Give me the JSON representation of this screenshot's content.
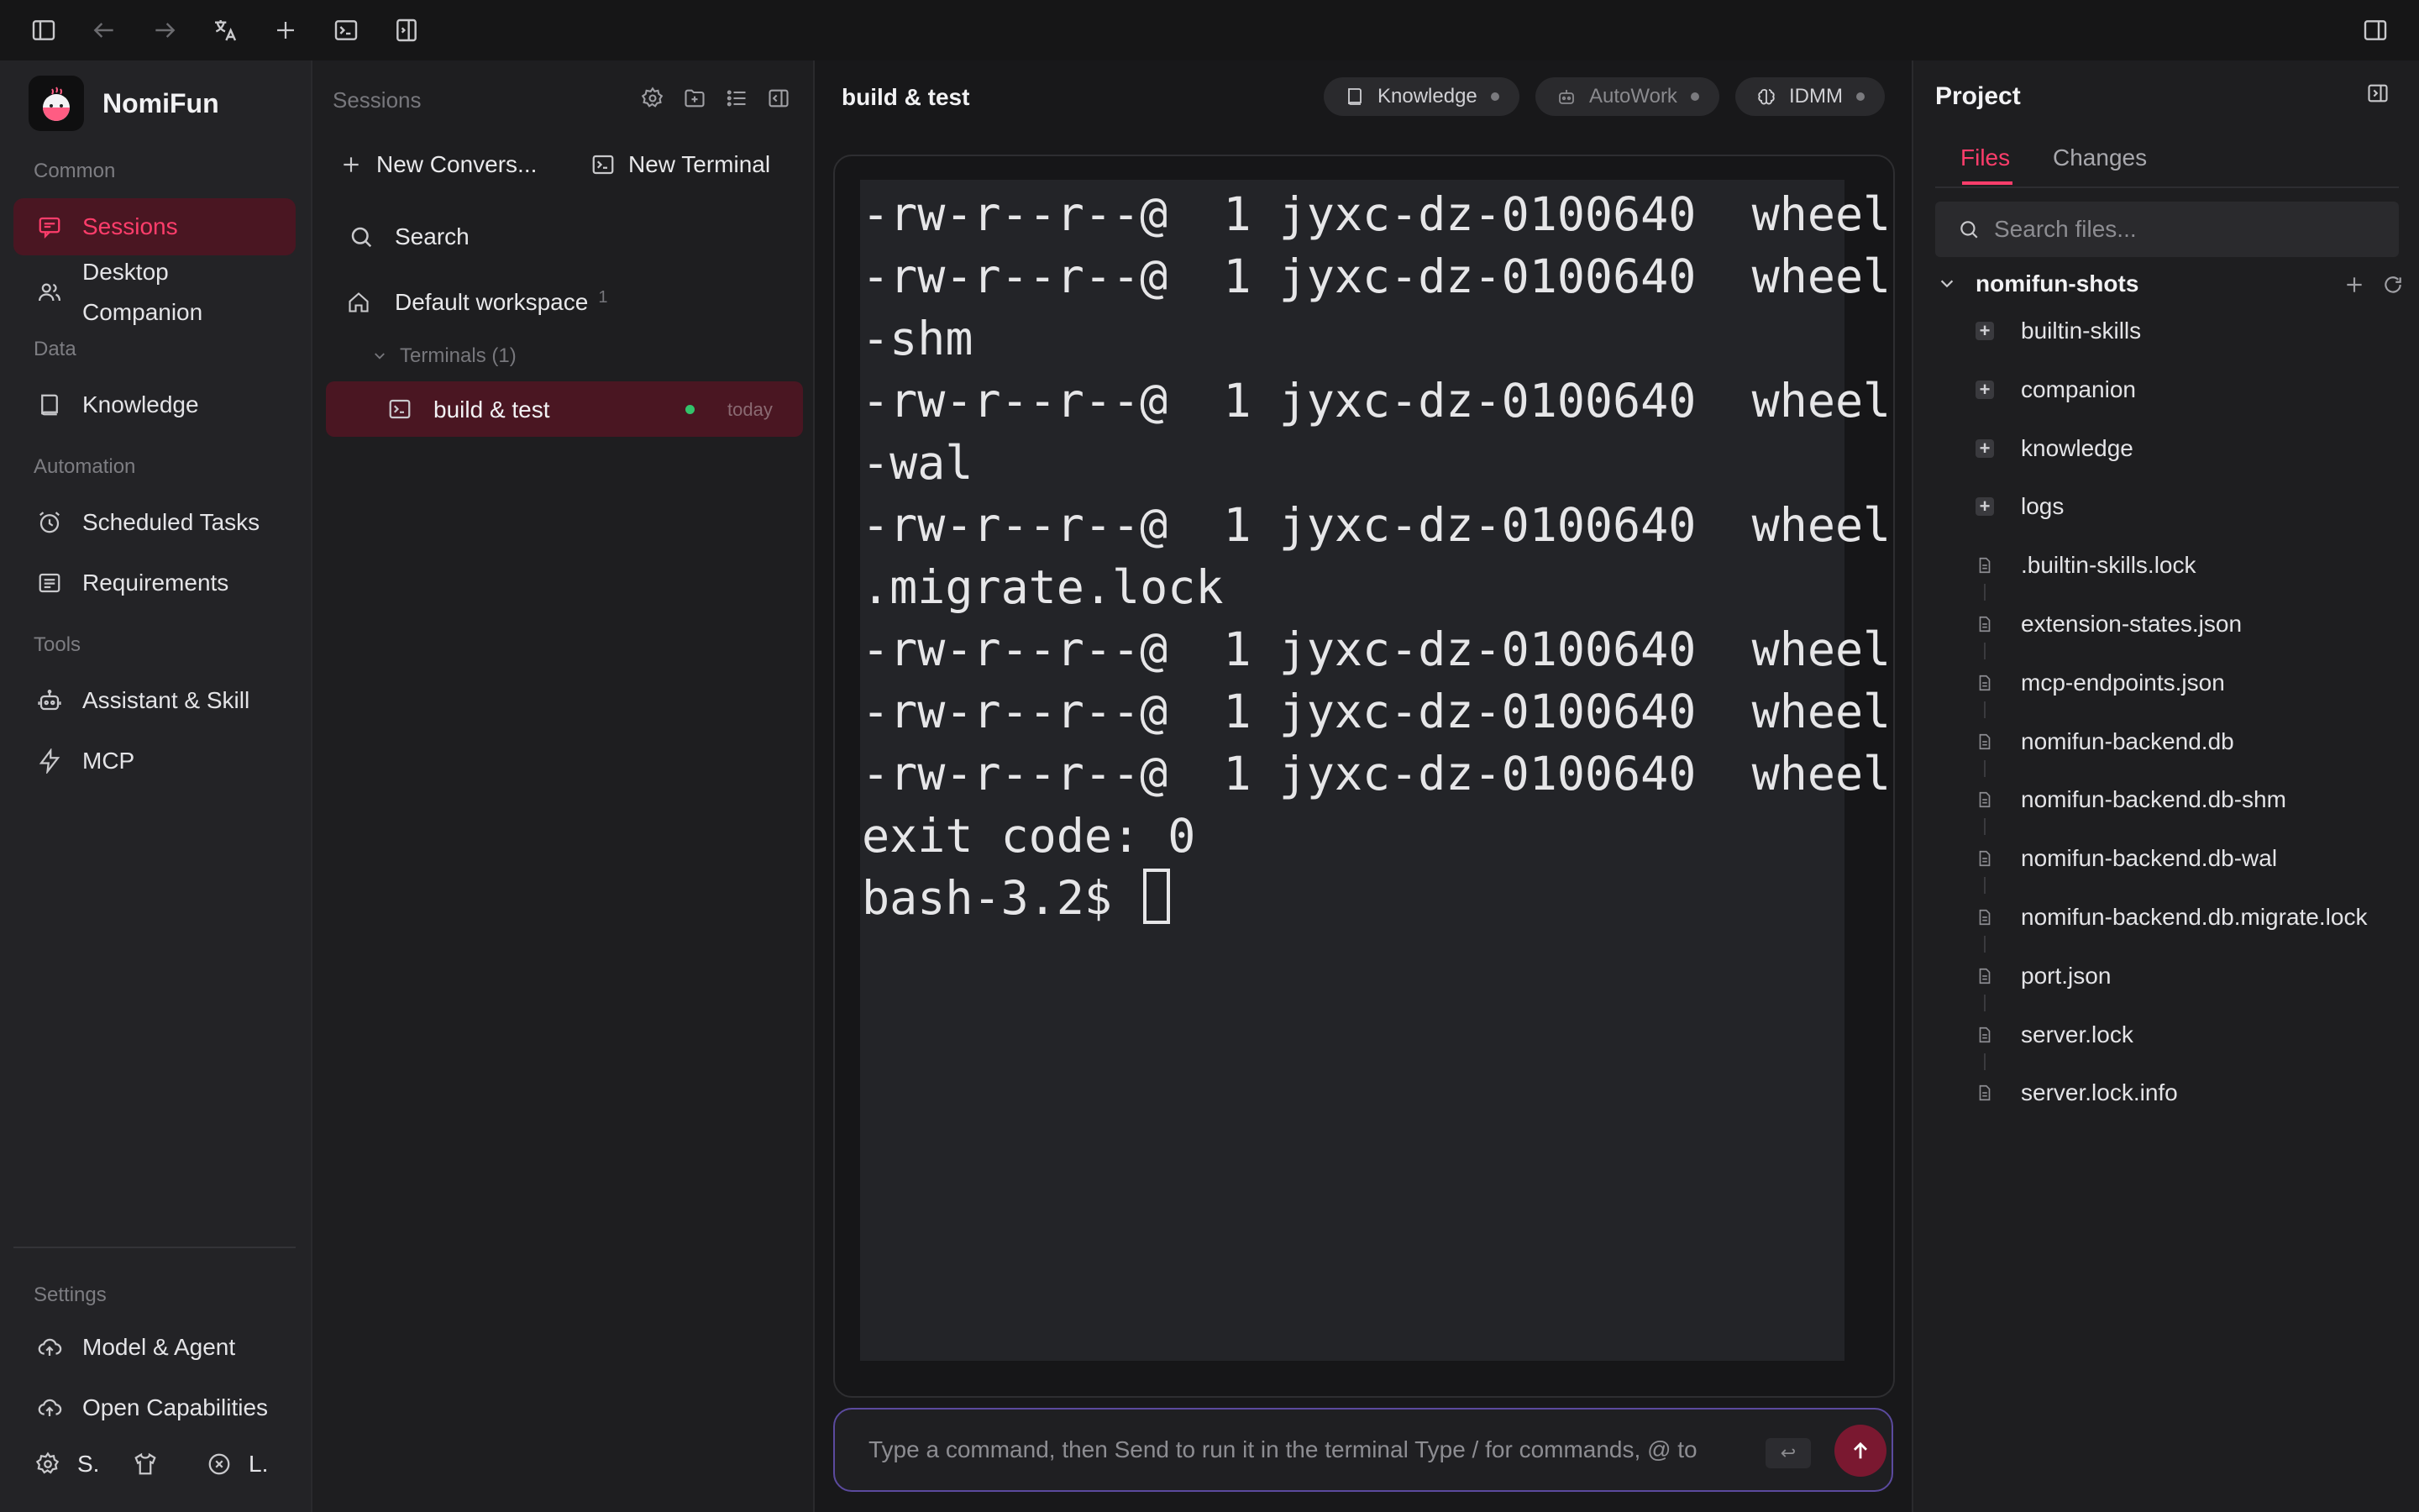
{
  "app": {
    "name": "NomiFun"
  },
  "sidebar": {
    "sections": {
      "common": "Common",
      "data": "Data",
      "automation": "Automation",
      "tools": "Tools",
      "settings": "Settings"
    },
    "items": {
      "sessions": "Sessions",
      "desktop_companion_1": "Desktop",
      "desktop_companion_2": "Companion",
      "knowledge": "Knowledge",
      "scheduled_tasks": "Scheduled Tasks",
      "requirements": "Requirements",
      "assistant_skill": "Assistant & Skill",
      "mcp": "MCP",
      "model_agent": "Model & Agent",
      "open_capabilities": "Open Capabilities"
    },
    "footer": {
      "s_label": "S.",
      "l_label": "L."
    }
  },
  "sessions_panel": {
    "title": "Sessions",
    "new_conversation": "New Convers...",
    "new_terminal": "New Terminal",
    "search": "Search",
    "workspace": {
      "name": "Default workspace",
      "count": "1"
    },
    "terminals_group": "Terminals (1)",
    "session": {
      "name": "build & test",
      "time": "today",
      "status_color": "#33c36b"
    }
  },
  "main": {
    "title": "build & test",
    "chips": {
      "knowledge": "Knowledge",
      "autowork": "AutoWork",
      "idmm": "IDMM"
    },
    "terminal": {
      "lines": [
        "-rw-r--r--@  1 jyxc-dz-0100640  wheel",
        "-rw-r--r--@  1 jyxc-dz-0100640  wheel",
        "-shm",
        "-rw-r--r--@  1 jyxc-dz-0100640  wheel",
        "-wal",
        "-rw-r--r--@  1 jyxc-dz-0100640  wheel",
        ".migrate.lock",
        "-rw-r--r--@  1 jyxc-dz-0100640  wheel",
        "-rw-r--r--@  1 jyxc-dz-0100640  wheel",
        "-rw-r--r--@  1 jyxc-dz-0100640  wheel",
        "exit code: 0"
      ],
      "prompt": "bash-3.2$ "
    },
    "input": {
      "placeholder": "Type a command, then Send to run it in the terminal Type / for commands, @ to",
      "enter_hint": "↩"
    }
  },
  "right_panel": {
    "title": "Project",
    "tabs": {
      "files": "Files",
      "changes": "Changes"
    },
    "search_placeholder": "Search files...",
    "root": "nomifun-shots",
    "folders": [
      "builtin-skills",
      "companion",
      "knowledge",
      "logs"
    ],
    "files": [
      ".builtin-skills.lock",
      "extension-states.json",
      "mcp-endpoints.json",
      "nomifun-backend.db",
      "nomifun-backend.db-shm",
      "nomifun-backend.db-wal",
      "nomifun-backend.db.migrate.lock",
      "port.json",
      "server.lock",
      "server.lock.info"
    ]
  },
  "colors": {
    "accent": "#ff3d6b",
    "active_bg": "#4a1622",
    "input_border": "#5b4a9e",
    "send_button": "#7a1830"
  }
}
